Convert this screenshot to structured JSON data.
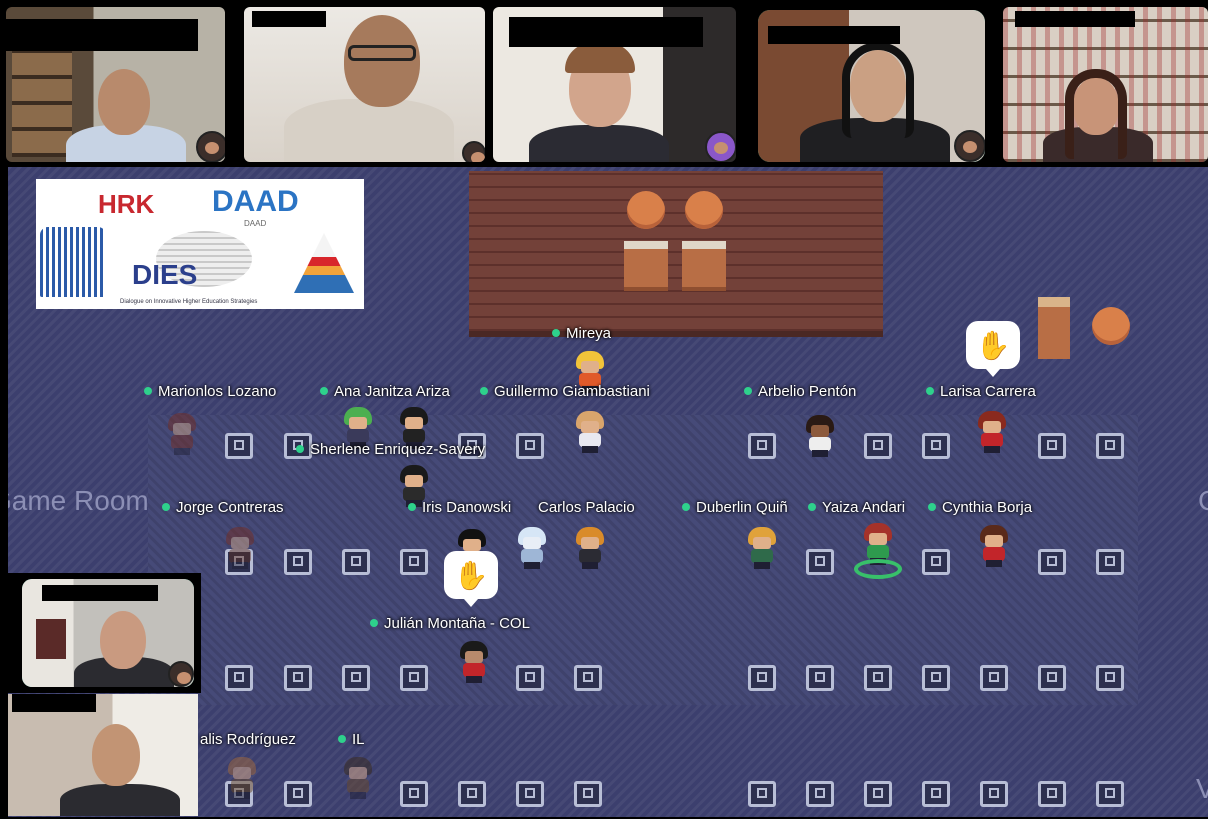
{
  "video_tiles": [
    {
      "id": "tile1",
      "label": ""
    },
    {
      "id": "tile2",
      "label": ""
    },
    {
      "id": "tile3",
      "label": ""
    },
    {
      "id": "tile4",
      "label": ""
    },
    {
      "id": "tile5",
      "label": ""
    },
    {
      "id": "tile6",
      "label": ""
    },
    {
      "id": "tile7",
      "label": ""
    }
  ],
  "logo": {
    "hrk": "HRK",
    "daad": "DAAD",
    "daad_small": "DAAD",
    "dies": "DIES",
    "tagline": "Dialogue on Innovative Higher Education Strategies"
  },
  "room": {
    "game_room_label": "Game Room",
    "partial_right_top": "C",
    "partial_right_bottom": "V"
  },
  "participants": {
    "mireya": "Mireya",
    "marion": "Marionlos Lozano",
    "ana": "Ana Janitza Ariza",
    "guillermo": "Guillermo Giambastiani",
    "arbelio": "Arbelio Pentón",
    "larisa": "Larisa Carrera",
    "sherlene": "Sherlene Enriquez-Savery",
    "jorge": "Jorge Contreras",
    "iris": "Iris Danowski",
    "carlos": "Carlos Palacio",
    "duberlin": "Duberlin Quiñ",
    "yaiza": "Yaiza Andari",
    "cynthia": "Cynthia Borja",
    "julian": "Julián Montaña - COL",
    "alis": "alis Rodríguez",
    "il": "IL"
  },
  "raised_hand_icon": "raised-hand-icon",
  "colors": {
    "map_bg": "#3c3f6e",
    "online_dot": "#2ed18c",
    "active_tile_border": "#3ad0a8",
    "stage": "#6b3a33"
  }
}
